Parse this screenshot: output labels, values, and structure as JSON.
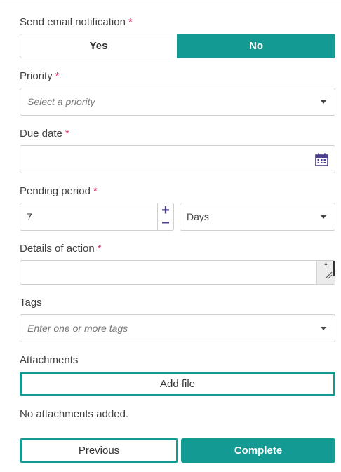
{
  "required_mark": "*",
  "email_notification": {
    "label": "Send email notification",
    "options": [
      "Yes",
      "No"
    ],
    "selected": "No"
  },
  "priority": {
    "label": "Priority",
    "placeholder": "Select a priority"
  },
  "due_date": {
    "label": "Due date",
    "value": ""
  },
  "pending_period": {
    "label": "Pending period",
    "value": "7",
    "unit": "Days"
  },
  "details": {
    "label": "Details of action",
    "value": ""
  },
  "tags": {
    "label": "Tags",
    "placeholder": "Enter one or more tags"
  },
  "attachments": {
    "label": "Attachments",
    "add_button": "Add file",
    "empty_text": "No attachments added."
  },
  "footer": {
    "previous": "Previous",
    "complete": "Complete"
  },
  "colors": {
    "accent": "#139a92",
    "required": "#d0315c",
    "icon": "#4a3f8c"
  }
}
